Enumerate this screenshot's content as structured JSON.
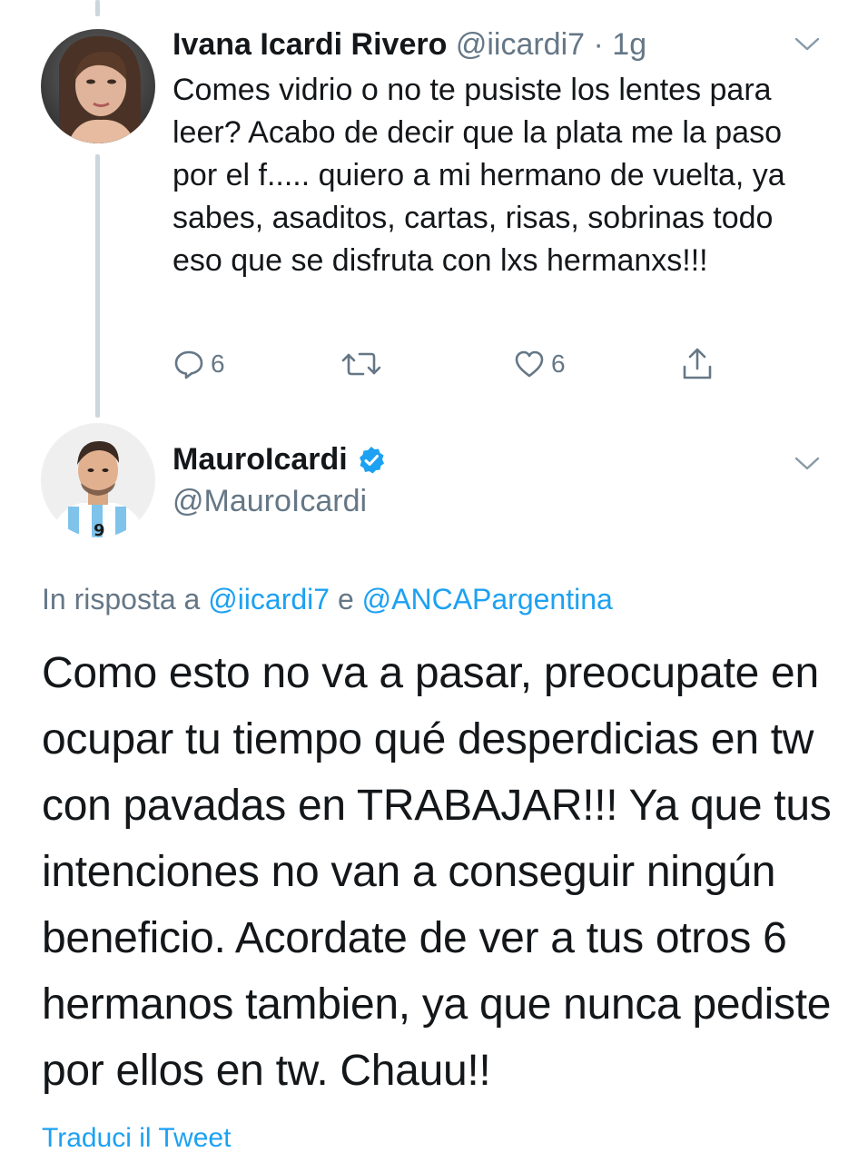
{
  "tweet1": {
    "display_name": "Ivana Icardi Rivero",
    "handle": "@iicardi7",
    "separator": "·",
    "time": "1g",
    "text": "Comes vidrio o no te pusiste los lentes para leer? Acabo de decir que la plata me la paso por el f..... quiero a mi hermano de vuelta, ya sabes, asaditos, cartas, risas, sobrinas todo eso que se disfruta con lxs hermanxs!!!",
    "reply_count": "6",
    "like_count": "6",
    "icons": [
      "comment-icon",
      "retweet-icon",
      "heart-icon",
      "share-icon",
      "chevron-down-icon"
    ]
  },
  "tweet2": {
    "display_name": "MauroIcardi",
    "verified": true,
    "handle": "@MauroIcardi",
    "reply_prefix": "In risposta a",
    "reply_to_1": "@iicardi7",
    "reply_conj": "e",
    "reply_to_2": "@ANCAPargentina",
    "text": "Como esto no va a pasar, preocupate en ocupar tu tiempo qué desperdicias en tw con pavadas en TRABAJAR!!! Ya que tus intenciones no van a conseguir ningún beneficio. Acordate de ver a tus otros 6 hermanos tambien, ya que nunca pediste por ellos en tw. Chauu!!",
    "translate_label": "Traduci il Tweet"
  },
  "colors": {
    "text": "#14171a",
    "muted": "#657786",
    "link": "#1da1f2",
    "thread_line": "#ccd6dd",
    "verified": "#1da1f2"
  }
}
